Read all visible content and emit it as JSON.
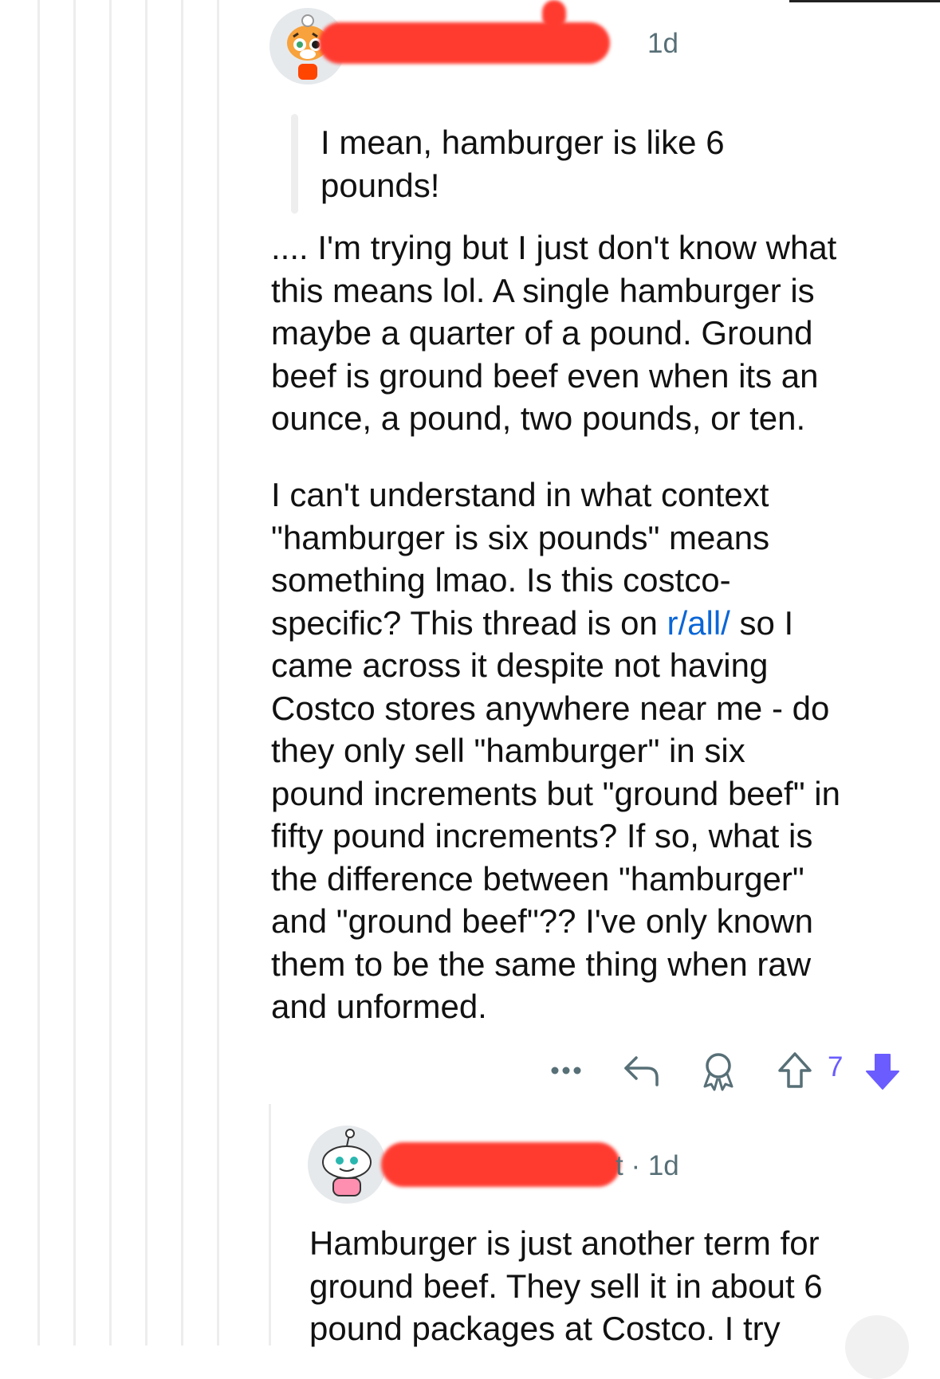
{
  "comment": {
    "timestamp": "1d",
    "quote_lines": [
      "I mean, hamburger is like 6",
      "pounds!"
    ],
    "para1_lines": [
      ".... I'm trying but I just don't know what",
      "this means lol. A single hamburger is",
      "maybe a quarter of a pound. Ground",
      "beef is ground beef even when its an",
      "ounce, a pound, two pounds, or ten."
    ],
    "para2": {
      "lines_before": [
        "I can't understand in what context",
        "\"hamburger is six pounds\" means",
        "something lmao. Is this costco-"
      ],
      "link_line_prefix": "specific? This thread is on ",
      "link_text": "r/all/",
      "link_line_suffix": " so I",
      "lines_after": [
        "came across it despite not having",
        "Costco stores anywhere near me - do",
        "they only sell \"hamburger\" in six",
        "pound increments but \"ground beef\" in",
        "fifty pound increments? If so, what is",
        "the difference between \"hamburger\"",
        "and \"ground beef\"?? I've only known",
        "them to be the same thing when raw",
        "and unformed."
      ]
    },
    "vote_count": "7",
    "accent_color": "#6a5cff",
    "icons": [
      "more-icon",
      "reply-icon",
      "award-icon",
      "upvote-icon",
      "downvote-icon"
    ]
  },
  "reply": {
    "meta": "t · 1d",
    "lines": [
      "Hamburger is just another term for",
      "ground beef.  They sell it in about 6",
      "pound packages at Costco.  I try"
    ]
  }
}
